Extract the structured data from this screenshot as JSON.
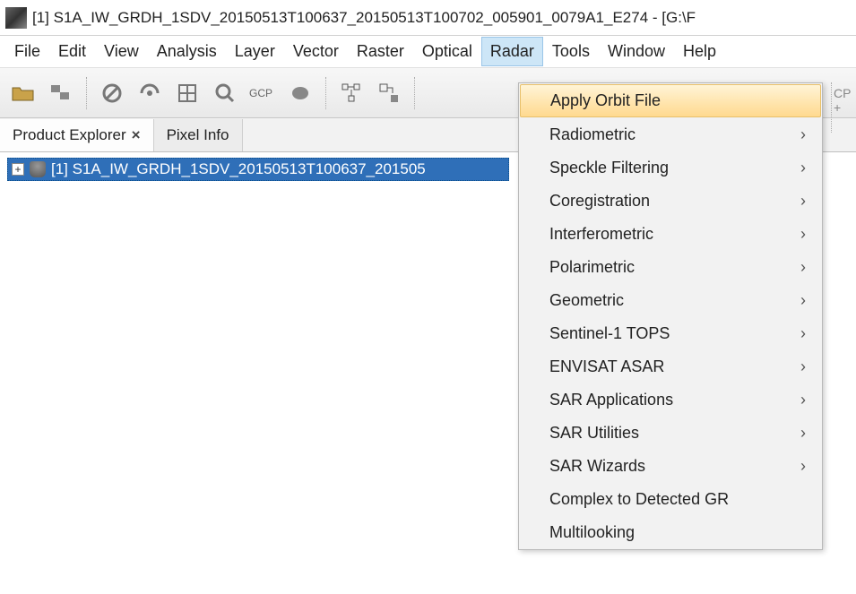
{
  "title": "[1] S1A_IW_GRDH_1SDV_20150513T100637_20150513T100702_005901_0079A1_E274 - [G:\\F",
  "menubar": {
    "items": [
      "File",
      "Edit",
      "View",
      "Analysis",
      "Layer",
      "Vector",
      "Raster",
      "Optical",
      "Radar",
      "Tools",
      "Window",
      "Help"
    ],
    "active_index": 8
  },
  "toolbar": {
    "icons": [
      "open-folder",
      "products",
      "slash-circle",
      "target",
      "grid",
      "zoom",
      "gcp",
      "blob",
      "graph",
      "convert"
    ]
  },
  "panel_right_hint": "CP\n+",
  "tabs": {
    "items": [
      {
        "label": "Product Explorer",
        "closable": true,
        "active": true
      },
      {
        "label": "Pixel Info",
        "closable": false,
        "active": false
      }
    ]
  },
  "tree": {
    "root_label": "[1] S1A_IW_GRDH_1SDV_20150513T100637_201505"
  },
  "dropdown": {
    "items": [
      {
        "label": "Apply Orbit File",
        "submenu": false,
        "highlight": true
      },
      {
        "label": "Radiometric",
        "submenu": true
      },
      {
        "label": "Speckle Filtering",
        "submenu": true
      },
      {
        "label": "Coregistration",
        "submenu": true
      },
      {
        "label": "Interferometric",
        "submenu": true
      },
      {
        "label": "Polarimetric",
        "submenu": true
      },
      {
        "label": "Geometric",
        "submenu": true
      },
      {
        "label": "Sentinel-1 TOPS",
        "submenu": true
      },
      {
        "label": "ENVISAT ASAR",
        "submenu": true
      },
      {
        "label": "SAR Applications",
        "submenu": true
      },
      {
        "label": "SAR Utilities",
        "submenu": true
      },
      {
        "label": "SAR Wizards",
        "submenu": true
      },
      {
        "label": "Complex to Detected GR",
        "submenu": false
      },
      {
        "label": "Multilooking",
        "submenu": false
      }
    ]
  }
}
